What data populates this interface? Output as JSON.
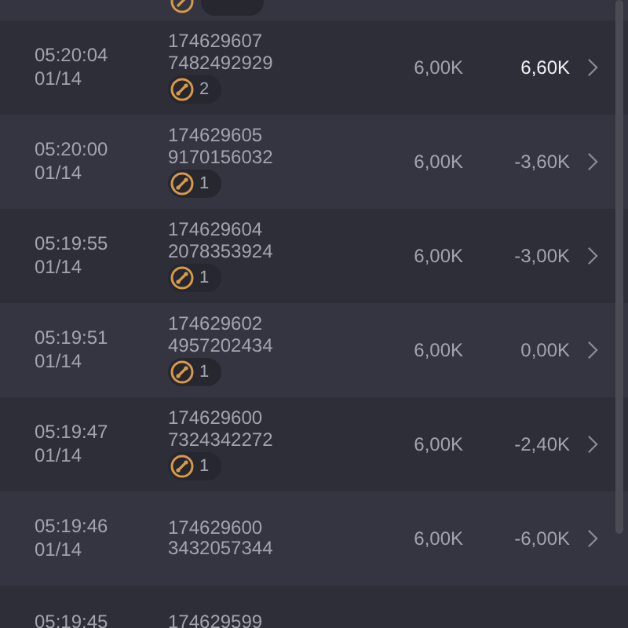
{
  "rows": [
    {
      "time": "05:20:04",
      "date": "01/14",
      "id_lines": [
        "174629607",
        "7482492929"
      ],
      "badge": {
        "count": "2"
      },
      "amount": "6,00K",
      "result": "6,60K",
      "highlighted": true
    },
    {
      "time": "05:20:00",
      "date": "01/14",
      "id_lines": [
        "174629605",
        "9170156032"
      ],
      "badge": {
        "count": "1"
      },
      "amount": "6,00K",
      "result": "-3,60K",
      "highlighted": false
    },
    {
      "time": "05:19:55",
      "date": "01/14",
      "id_lines": [
        "174629604",
        "2078353924"
      ],
      "badge": {
        "count": "1"
      },
      "amount": "6,00K",
      "result": "-3,00K",
      "highlighted": false
    },
    {
      "time": "05:19:51",
      "date": "01/14",
      "id_lines": [
        "174629602",
        "4957202434"
      ],
      "badge": {
        "count": "1"
      },
      "amount": "6,00K",
      "result": "0,00K",
      "highlighted": false
    },
    {
      "time": "05:19:47",
      "date": "01/14",
      "id_lines": [
        "174629600",
        "7324342272"
      ],
      "badge": {
        "count": "1"
      },
      "amount": "6,00K",
      "result": "-2,40K",
      "highlighted": false
    },
    {
      "time": "05:19:46",
      "date": "01/14",
      "id_lines": [
        "174629600",
        "3432057344"
      ],
      "amount": "6,00K",
      "result": "-6,00K",
      "highlighted": false
    }
  ],
  "partial_row": {
    "time": "05:19:45",
    "id": "174629599"
  }
}
